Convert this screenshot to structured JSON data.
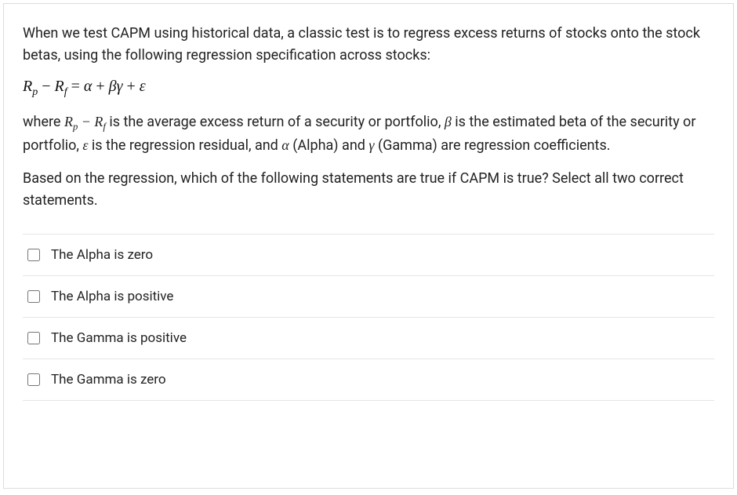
{
  "question": {
    "p1": "When we test CAPM using historical data, a classic test is to regress excess returns of stocks onto the stock betas, using the following regression specification across stocks:",
    "formula_html": "R<span class='sub'>p</span> <span class='rm'>−</span> R<span class='sub'>f</span> <span class='rm'>=</span> α <span class='rm'>+</span> βγ <span class='rm'>+</span> ε",
    "p2_html": "where <span class='math-inline'>R<span class=\"sub\">p</span> − R<span class=\"sub\">f</span></span> is the average excess return of a security or portfolio, <span class='math-inline'>β</span> is the estimated beta of the security or portfolio, <span class='math-inline'>ε</span> is the regression residual, and <span class='math-inline'>α</span> (Alpha) and <span class='math-inline'>γ</span> (Gamma) are regression coefficients.",
    "p3": "Based on the regression, which of the following statements are true if CAPM is true? Select all two correct statements."
  },
  "options": [
    {
      "label": "The Alpha is zero"
    },
    {
      "label": "The Alpha is positive"
    },
    {
      "label": "The Gamma is positive"
    },
    {
      "label": "The Gamma is zero"
    }
  ]
}
